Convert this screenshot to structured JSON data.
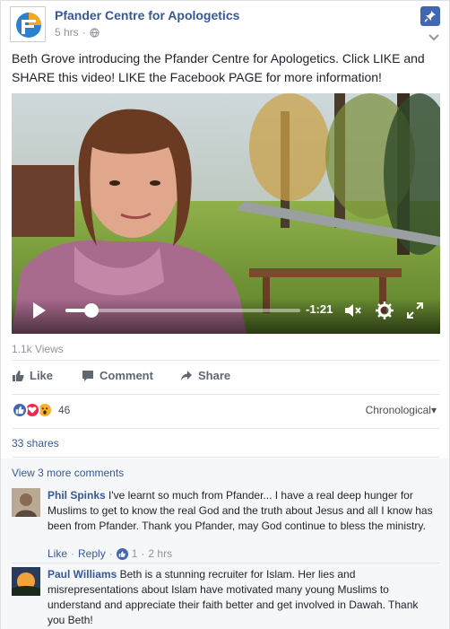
{
  "post": {
    "page_name": "Pfander Centre for Apologetics",
    "time": "5 hrs",
    "separator": "·",
    "text": "Beth Grove introducing the Pfander Centre for Apologetics. Click LIKE and SHARE this video! LIKE the Facebook PAGE for more information!"
  },
  "video": {
    "time_remaining": "-1:21",
    "progress": 0.11
  },
  "views": "1.1k Views",
  "actions": {
    "like": "Like",
    "comment": "Comment",
    "share": "Share"
  },
  "reactions": {
    "count": "46",
    "sort": "Chronological"
  },
  "shares": "33 shares",
  "comments": {
    "view_more": "View 3 more comments",
    "items": [
      {
        "author": "Phil Spinks",
        "text": "I've learnt so much from Pfander... I have a real deep hunger for Muslims to get to know the real God and the truth about Jesus and all I know has been from Pfander. Thank you Pfander, may God continue to bless the ministry.",
        "like": "Like",
        "reply": "Reply",
        "likes": "1",
        "time": "2 hrs",
        "dot": "·"
      },
      {
        "author": "Paul Williams",
        "text": "Beth is a stunning recruiter for Islam. Her lies and misrepresentations about Islam have motivated many young Muslims to understand and appreciate their faith better and get involved in Dawah. Thank you Beth!"
      }
    ]
  },
  "colors": {
    "link": "#365899",
    "brand": "#4267b2",
    "muted": "#90949c"
  }
}
